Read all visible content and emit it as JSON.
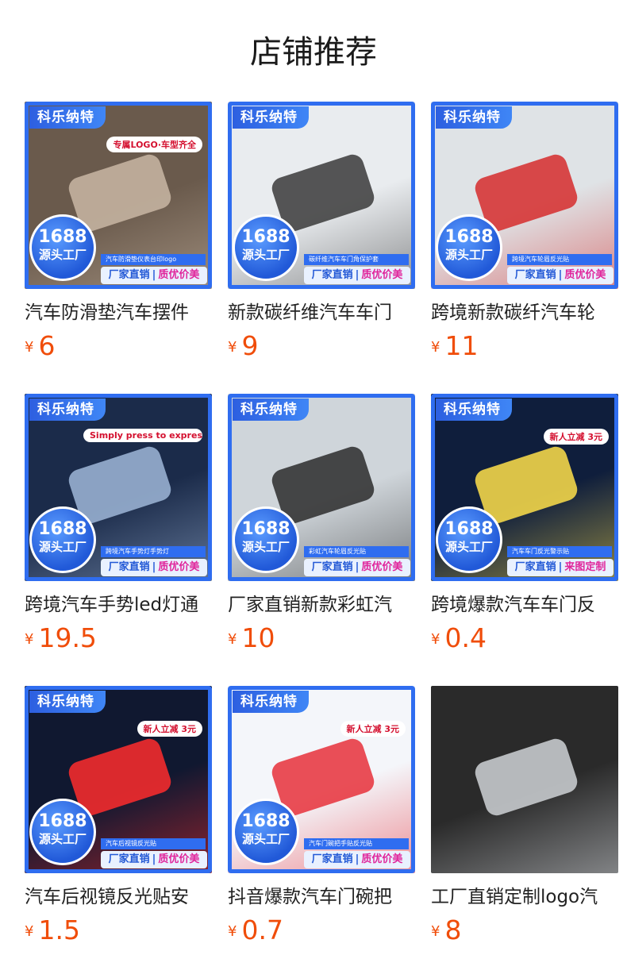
{
  "header": {
    "title": "店铺推荐"
  },
  "common": {
    "brand": "科乐纳特",
    "badge_line1": "1688",
    "badge_line2": "源头工厂",
    "bar_left": "厂家直销",
    "bar_sep": "|"
  },
  "products": [
    {
      "caption": "汽车防滑垫汽车摆件",
      "currency": "¥",
      "price": "6",
      "strip": "汽车防滑垫仪表台印logo",
      "bar_right": "质优价美",
      "tag": "专属LOGO·车型齐全",
      "scene_color": "#6a5a4c",
      "accent": "#c9b7a4"
    },
    {
      "caption": "新款碳纤维汽车车门",
      "currency": "¥",
      "price": "9",
      "strip": "碳纤维汽车车门角保护套",
      "bar_right": "质优价美",
      "tag": "",
      "scene_color": "#e9ecef",
      "accent": "#3a3a3a"
    },
    {
      "caption": "跨境新款碳纤汽车轮",
      "currency": "¥",
      "price": "11",
      "strip": "跨境汽车轮眉反光贴",
      "bar_right": "质优价美",
      "tag": "",
      "scene_color": "#dfe3e6",
      "accent": "#d62b2b"
    },
    {
      "caption": "跨境汽车手势led灯通",
      "currency": "¥",
      "price": "19.5",
      "strip": "跨境汽车手势灯手势灯",
      "bar_right": "质优价美",
      "tag": "Simply press to express",
      "scene_color": "#1b2b4a",
      "accent": "#9fb7d8"
    },
    {
      "caption": "厂家直销新款彩虹汽",
      "currency": "¥",
      "price": "10",
      "strip": "彩虹汽车轮眉反光贴",
      "bar_right": "质优价美",
      "tag": "",
      "scene_color": "#cfd5da",
      "accent": "#2b2b2b"
    },
    {
      "caption": "跨境爆款汽车车门反",
      "currency": "¥",
      "price": "0.4",
      "strip": "汽车车门反光警示贴",
      "bar_right": "来图定制",
      "tag": "新人立减 3元",
      "scene_color": "#0f1e3c",
      "accent": "#ffe14a"
    },
    {
      "caption": "汽车后视镜反光贴安",
      "currency": "¥",
      "price": "1.5",
      "strip": "汽车后视镜反光贴",
      "bar_right": "质优价美",
      "tag": "新人立减 3元",
      "scene_color": "#101830",
      "accent": "#ff2d2d"
    },
    {
      "caption": "抖音爆款汽车门碗把",
      "currency": "¥",
      "price": "0.7",
      "strip": "汽车门碗把手贴反光贴",
      "bar_right": "质优价美",
      "tag": "新人立减 3元",
      "scene_color": "#f4f6fa",
      "accent": "#e6303a"
    },
    {
      "caption": "工厂直销定制logo汽",
      "currency": "¥",
      "price": "8",
      "strip": "",
      "bar_right": "",
      "tag": "",
      "scene_color": "#2a2a2a",
      "accent": "#cfd2d6"
    }
  ]
}
